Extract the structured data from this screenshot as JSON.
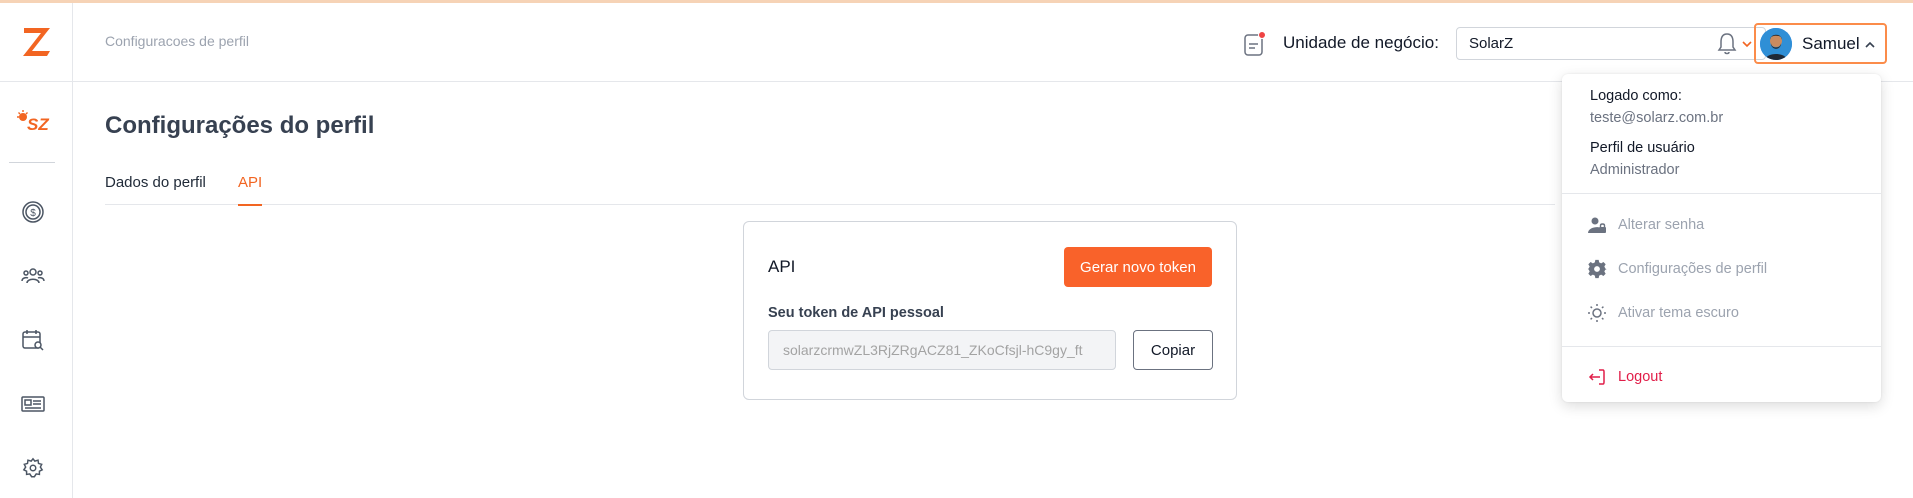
{
  "header": {
    "breadcrumb": "Configuracoes de perfil",
    "business_unit_label": "Unidade de negócio:",
    "business_unit_value": "SolarZ",
    "user_name": "Samuel"
  },
  "page": {
    "title": "Configurações do perfil",
    "tabs": [
      {
        "label": "Dados do perfil",
        "active": false
      },
      {
        "label": "API",
        "active": true
      }
    ]
  },
  "api_card": {
    "title": "API",
    "generate_button": "Gerar novo token",
    "token_label": "Seu token de API pessoal",
    "token_value": "solarzcrmwZL3RjZRgACZ81_ZKoCfsjl-hC9gy_ft",
    "copy_button": "Copiar"
  },
  "user_menu": {
    "logged_as_label": "Logado como:",
    "email": "teste@solarz.com.br",
    "profile_label": "Perfil de usuário",
    "profile_value": "Administrador",
    "items": [
      {
        "label": "Alterar senha",
        "icon": "user-lock-icon"
      },
      {
        "label": "Configurações de perfil",
        "icon": "gear-icon"
      },
      {
        "label": "Ativar tema escuro",
        "icon": "sun-icon"
      }
    ],
    "logout": "Logout"
  },
  "colors": {
    "accent": "#f9622a",
    "logout": "#e11d48",
    "notification_dot": "#ef4444"
  }
}
